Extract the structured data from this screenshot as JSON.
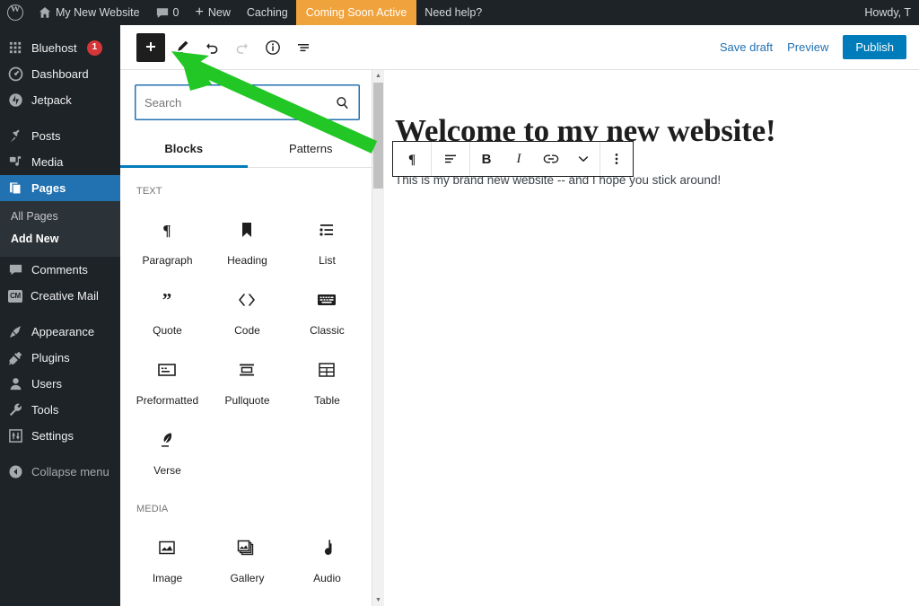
{
  "adminbar": {
    "logo_icon": "wordpress-logo-icon",
    "site_name": "My New Website",
    "comments_count": "0",
    "new_label": "New",
    "caching_label": "Caching",
    "coming_soon_label": "Coming Soon Active",
    "help_label": "Need help?",
    "howdy_label": "Howdy, T",
    "orange": "#f0a23c",
    "bg": "#1d2327"
  },
  "sidebar": {
    "bg": "#1d2327",
    "current_color": "#2271b1",
    "badge_color": "#d63638",
    "items": [
      {
        "label": "Bluehost",
        "icon": "grid-icon",
        "badge": "1"
      },
      {
        "label": "Dashboard",
        "icon": "dashboard-icon"
      },
      {
        "label": "Jetpack",
        "icon": "jetpack-icon"
      },
      {
        "label": "Posts",
        "icon": "pin-icon"
      },
      {
        "label": "Media",
        "icon": "media-icon"
      },
      {
        "label": "Pages",
        "icon": "pages-icon"
      },
      {
        "label": "Comments",
        "icon": "comment-icon"
      },
      {
        "label": "Creative Mail",
        "icon": "creative-mail-icon"
      },
      {
        "label": "Appearance",
        "icon": "appearance-icon"
      },
      {
        "label": "Plugins",
        "icon": "plugin-icon"
      },
      {
        "label": "Users",
        "icon": "user-icon"
      },
      {
        "label": "Tools",
        "icon": "wrench-icon"
      },
      {
        "label": "Settings",
        "icon": "settings-icon"
      },
      {
        "label": "Collapse menu",
        "icon": "collapse-icon"
      }
    ],
    "submenu": [
      {
        "label": "All Pages",
        "active": false
      },
      {
        "label": "Add New",
        "active": true
      }
    ]
  },
  "editor_header": {
    "add_block_icon": "plus-icon",
    "tools_icon": "pencil-icon",
    "undo_icon": "undo-icon",
    "redo_icon": "redo-icon",
    "details_icon": "info-icon",
    "list_view_icon": "list-view-icon",
    "save_draft_label": "Save draft",
    "preview_label": "Preview",
    "publish_label": "Publish",
    "publish_color": "#007cba",
    "link_color": "#2271b1"
  },
  "inserter": {
    "search_placeholder": "Search",
    "search_value": "",
    "search_icon": "search-icon",
    "tabs": [
      {
        "label": "Blocks",
        "active": true
      },
      {
        "label": "Patterns",
        "active": false
      }
    ],
    "sections": [
      {
        "title": "TEXT",
        "blocks": [
          {
            "label": "Paragraph",
            "icon": "paragraph-icon"
          },
          {
            "label": "Heading",
            "icon": "heading-icon"
          },
          {
            "label": "List",
            "icon": "list-icon"
          },
          {
            "label": "Quote",
            "icon": "quote-icon"
          },
          {
            "label": "Code",
            "icon": "code-icon"
          },
          {
            "label": "Classic",
            "icon": "classic-icon"
          },
          {
            "label": "Preformatted",
            "icon": "preformatted-icon"
          },
          {
            "label": "Pullquote",
            "icon": "pullquote-icon"
          },
          {
            "label": "Table",
            "icon": "table-icon"
          },
          {
            "label": "Verse",
            "icon": "verse-icon"
          }
        ]
      },
      {
        "title": "MEDIA",
        "blocks": [
          {
            "label": "Image",
            "icon": "image-icon"
          },
          {
            "label": "Gallery",
            "icon": "gallery-icon"
          },
          {
            "label": "Audio",
            "icon": "audio-icon"
          }
        ]
      }
    ]
  },
  "canvas": {
    "title": "Welcome to my new website!",
    "paragraph": "This is my brand new website -- and I hope you stick around!",
    "block_toolbar": {
      "block_type_icon": "paragraph-icon",
      "align_icon": "align-icon",
      "bold_label": "B",
      "italic_label": "I",
      "link_icon": "link-icon",
      "more_icon": "chevron-down-icon",
      "options_icon": "more-vertical-icon"
    }
  },
  "annotation": {
    "arrow_color": "#22c726",
    "type": "arrow",
    "points_to": "add-block-button"
  }
}
